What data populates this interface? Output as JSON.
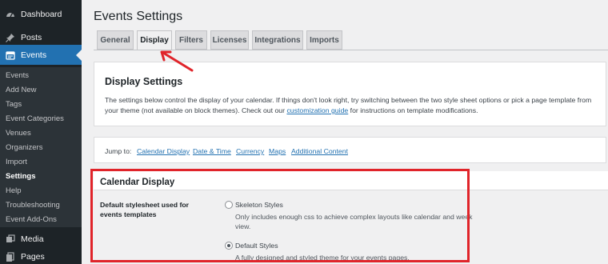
{
  "sidebar": {
    "dashboard": "Dashboard",
    "posts": "Posts",
    "events": "Events",
    "media": "Media",
    "pages": "Pages",
    "submenu": [
      "Events",
      "Add New",
      "Tags",
      "Event Categories",
      "Venues",
      "Organizers",
      "Import",
      "Settings",
      "Help",
      "Troubleshooting",
      "Event Add-Ons"
    ],
    "current": "Settings",
    "accent_color": "#2271b1"
  },
  "page": {
    "title": "Events Settings",
    "tabs": [
      "General",
      "Display",
      "Filters",
      "Licenses",
      "Integrations",
      "Imports"
    ],
    "active_tab": "Display"
  },
  "display_settings": {
    "title": "Display Settings",
    "desc_part1": "The settings below control the display of your calendar. If things don't look right, try switching between the two style sheet options or pick a page template from your theme (not available on block themes). Check out our ",
    "desc_link": "customization guide",
    "desc_part2": " for instructions on template modifications."
  },
  "jump": {
    "label": "Jump to:",
    "links": [
      "Calendar Display",
      "Date & Time",
      "Currency",
      "Maps",
      "Additional Content"
    ]
  },
  "calendar_display": {
    "title": "Calendar Display",
    "field_label": "Default stylesheet used for events templates",
    "options": [
      {
        "label": "Skeleton Styles",
        "desc": "Only includes enough css to achieve complex layouts like calendar and week view.",
        "checked": false
      },
      {
        "label": "Default Styles",
        "desc": "A fully designed and styled theme for your events pages.",
        "checked": true
      }
    ]
  },
  "annotation": {
    "highlight_color": "#e0242a"
  }
}
